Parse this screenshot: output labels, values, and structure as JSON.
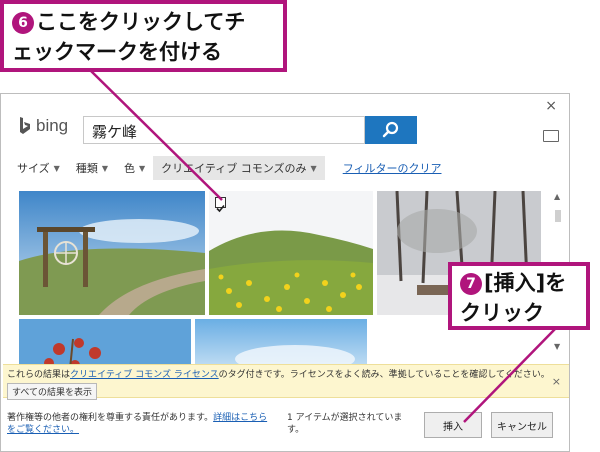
{
  "callouts": {
    "step6": {
      "number": "6",
      "line1": "ここをクリックしてチ",
      "line2": "ェックマークを付ける"
    },
    "step7": {
      "number": "7",
      "line1": "[挿入]を",
      "line2": "クリック"
    }
  },
  "dialog": {
    "close_glyph": "×",
    "search": {
      "brand": "bing",
      "value": "霧ケ峰"
    },
    "filters": {
      "size": "サイズ",
      "type": "種類",
      "color": "色",
      "license": "クリエイティブ コモンズのみ",
      "clear": "フィルターのクリア"
    },
    "notice": {
      "text_before": "これらの結果は",
      "link": "クリエイティブ コモンズ ライセンス",
      "text_after": "のタグ付きです。ライセンスをよく読み、準拠していることを確認してください。",
      "show_all": "すべての結果を表示",
      "close_glyph": "×"
    },
    "footer": {
      "text": "著作権等の他者の権利を尊重する責任があります。",
      "link": "詳細はこちらをご覧ください。",
      "selected": "1 アイテムが選択されています。",
      "insert": "挿入",
      "cancel": "キャンセル"
    }
  },
  "colors": {
    "accent": "#b0157c",
    "search_button": "#1e76bf",
    "link": "#1a5fb4",
    "notice_bg": "#fdf6cf"
  }
}
